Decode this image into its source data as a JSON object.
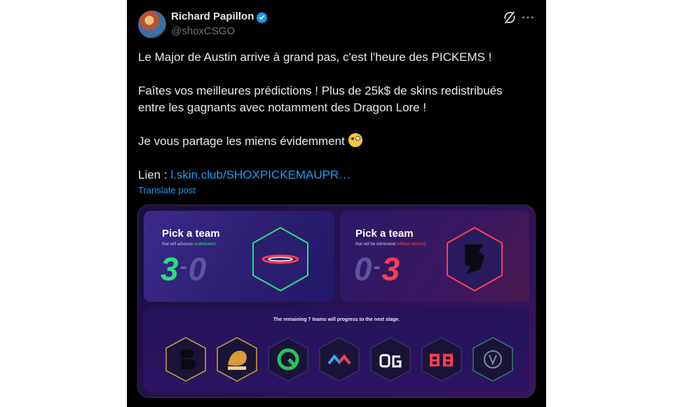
{
  "author": {
    "display_name": "Richard Papillon",
    "handle": "@shoxCSGO",
    "verified": true
  },
  "icons": {
    "verified": "verified-badge-icon",
    "grok": "grok-icon",
    "more": "more-options-icon"
  },
  "tweet": {
    "line1": "Le Major de Austin arrive à grand pas, c'est l'heure des PICKEMS !",
    "line2": "Faîtes vos meilleures prédictions ! Plus de 25k$ de skins redistribués",
    "line3": "entre les gagnants avec notamment des Dragon Lore !",
    "line4": "Je vous partage les miens évidemment",
    "link_prefix": "Lien : ",
    "link_text": "l.skin.club/SHOXPICKEMAUPR…",
    "translate_label": "Translate post"
  },
  "media": {
    "left_card": {
      "title": "Pick a team",
      "subtitle_prefix": "that will advance ",
      "subtitle_highlight": "undefeated",
      "score_left": "3",
      "score_right": "0"
    },
    "right_card": {
      "title": "Pick a team",
      "subtitle_prefix": "that will be eliminated ",
      "subtitle_highlight": "without winning",
      "score_left": "0",
      "score_right": "3"
    },
    "remaining_text": "The remaining 7 teams will progress to the next stage.",
    "team_logos": [
      "B8",
      "Lynn Vision",
      "Imperial",
      "Monte",
      "OG",
      "Betboom",
      "Eternal Fire"
    ]
  },
  "colors": {
    "background": "#000000",
    "text": "#e7e9ea",
    "secondary_text": "#71767b",
    "link": "#1d9bf0",
    "advance_green": "#27e07b",
    "eliminate_red": "#ff3d4f"
  }
}
